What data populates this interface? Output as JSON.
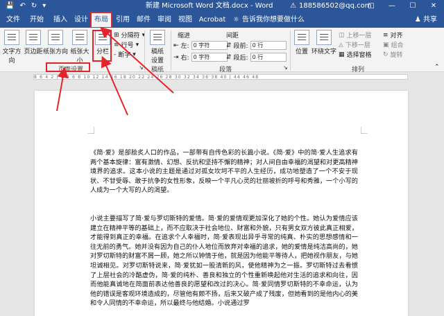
{
  "titlebar": {
    "title": "新建 Microsoft Word 文档.docx  -  Word",
    "account": "188586502@qq.com",
    "save_icon": "save-icon",
    "undo_icon": "undo-icon",
    "redo_icon": "redo-icon"
  },
  "tabs": [
    "文件",
    "开始",
    "插入",
    "设计",
    "布局",
    "引用",
    "邮件",
    "审阅",
    "视图",
    "Acrobat"
  ],
  "active_tab": "布局",
  "tellme": "告诉我你想要做什么",
  "share": "共享",
  "ribbon": {
    "page_setup": {
      "text_direction": "文字方向",
      "margins": "页边距",
      "orientation": "纸张方向",
      "size": "纸张大小",
      "columns": "分栏",
      "breaks": "分隔符",
      "line_numbers": "行号",
      "hyphenation": "断字",
      "group_label": "页面设置"
    },
    "draft": {
      "label_line1": "稿纸",
      "label_line2": "设置",
      "group_label": "稿纸"
    },
    "paragraph": {
      "indent_title": "缩进",
      "spacing_title": "间距",
      "left_label": "左:",
      "left_value": "0 字符",
      "right_label": "右:",
      "right_value": "0 字符",
      "before_label": "段前:",
      "before_value": "0 行",
      "after_label": "段后:",
      "after_value": "0 行",
      "group_label": "段落"
    },
    "arrange": {
      "position": "位置",
      "wrap": "环绕文字",
      "bring_forward": "上移一层",
      "send_backward": "下移一层",
      "selection_pane": "选择窗格",
      "align": "对齐",
      "group": "组合",
      "rotate": "旋转",
      "group_label": "排列"
    }
  },
  "ruler_marks": "8 6 4 2 | 2 4 6 8 10 12 14 16 18 20 22 24 26 28 30 32 34 36 38 40 | 44 46 48",
  "document": {
    "paragraph1": "《简·爱》是部脍炙人口的作品，一部带有自传色彩的长篇小说。《简·爱》中的简·爱人生追求有两个基本旋律：富有激情、幻想、反抗和坚持不懈的精神；对人间自由幸福的渴望和对更高精神境界的追求。这本小说的主题是通过对孤女坎坷不平的人生经历，成功地塑造了一个不安于现状、不甘受辱、敢于抗争的女性形象，反映一个平凡心灵的壮丽坡折的呼号和秀雅，一个小写的人成为一个大写的人的渴望。",
    "paragraph2": "小说主要描写了简·爱与罗切斯特的爱情。简·爱的爱情观更加深化了她的个性。她认为爱情应该建立在精神平等的基础上，而不应取决于社会地位、财富和外貌，只有男女双方彼此真正相爱，才能得到真正的幸福。在追求个人幸福时，简·爱表现出异乎寻常的纯真、朴实的思想感情和一往无前的勇气。她并没有因为自己的仆人地位而放弃对幸福的追求，她的爱情是纯洁高尚的，她对罗切斯特的财富不屑一顾，她之所以钟情于他，就是因为他能平等待人，把她视作朋友，与她坦诚相见。对罗切斯特说来，简·爱犹如一股清新的风，使他精神为之一振。罗切斯特过去看惯了上层社会的冷酷虚伪，简·爱的纯朴、善良和独立的个性重新唤起他对生活的追求和向往，因而他能真诚地在简面前表达他善良的愿望和改过的决心。简·爱同情罗切斯特的不幸命运，认为他的错误是客观环境造成的，尽管他有颇不扬，后来又破产成了残废，但她看到的是他内心的美和令人同情的不幸命运，所以最终与他结婚。小说通过罗"
  }
}
